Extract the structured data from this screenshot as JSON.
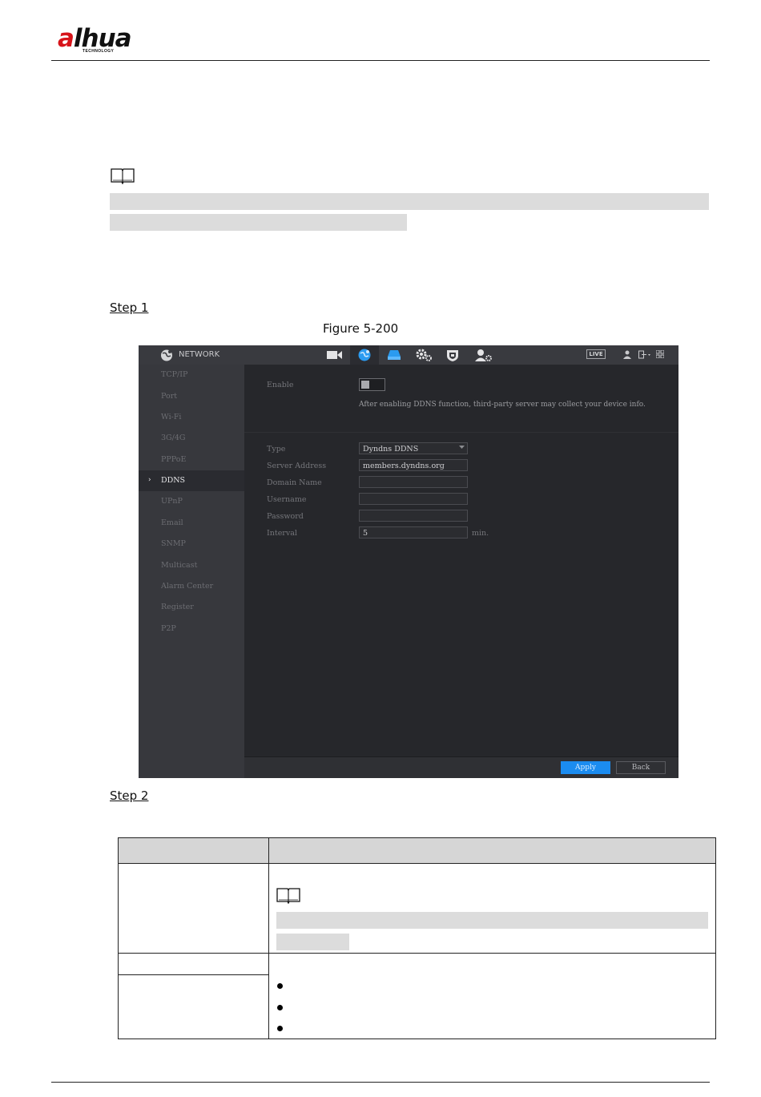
{
  "header": {
    "brand": "alhua",
    "brand_sub": "TECHNOLOGY"
  },
  "step1": "Step 1",
  "figure_caption": "Figure 5-200",
  "step2": "Step 2",
  "ui": {
    "nav_title": "NETWORK",
    "live_badge": "LIVE",
    "sidebar": [
      "TCP/IP",
      "Port",
      "Wi-Fi",
      "3G/4G",
      "PPPoE",
      "DDNS",
      "UPnP",
      "Email",
      "SNMP",
      "Multicast",
      "Alarm Center",
      "Register",
      "P2P"
    ],
    "active_item": "DDNS",
    "enable_label": "Enable",
    "enable_on": false,
    "notice": "After enabling DDNS function, third-party server may collect your device info.",
    "fields": [
      {
        "label": "Type",
        "value": "Dyndns DDNS"
      },
      {
        "label": "Server Address",
        "value": "members.dyndns.org"
      },
      {
        "label": "Domain Name",
        "value": ""
      },
      {
        "label": "Username",
        "value": ""
      },
      {
        "label": "Password",
        "value": ""
      },
      {
        "label": "Interval",
        "value": "5"
      }
    ],
    "interval_unit": "min.",
    "apply": "Apply",
    "back": "Back",
    "colors": {
      "accent": "#1b8cf0",
      "background": "#26272b"
    }
  }
}
